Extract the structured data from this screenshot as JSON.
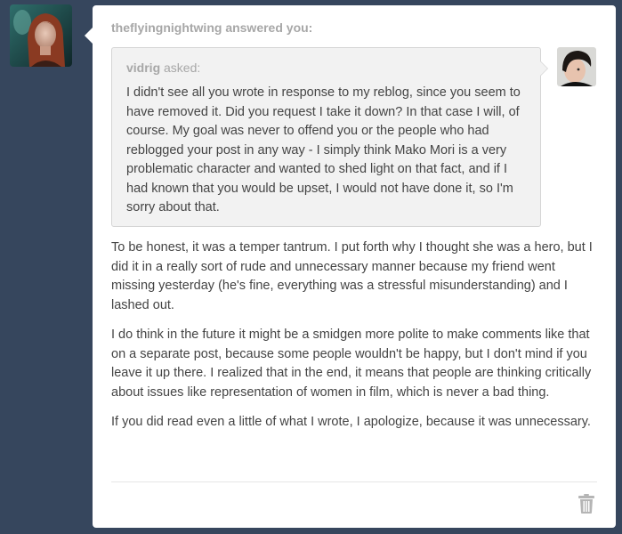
{
  "responder": {
    "username": "theflyingnightwing",
    "header_suffix": "answered you:"
  },
  "question": {
    "asker_name": "vidrig",
    "asked_label": "asked:",
    "text": "I didn't see all you wrote in response to my reblog, since you seem to have removed it. Did you request I take it down? In that case I will, of course. My goal was never to offend you or the people who had reblogged your post in any way - I simply think Mako Mori is a very problematic character and wanted to shed light on that fact, and if I had known that you would be upset, I would not have done it, so I'm sorry about that."
  },
  "answer": {
    "paragraphs": [
      "To be honest, it was a temper tantrum. I put forth why I thought she was a hero, but I did it in a really sort of rude and unnecessary manner because my friend went missing yesterday (he's fine, everything was a stressful misunderstanding) and I lashed out.",
      "I do think in the future it might be a smidgen more polite to make comments like that on a separate post, because some people wouldn't be happy, but I don't mind if you leave it up there. I realized that in the end, it means that people are thinking critically about issues like representation of women in film, which is never a bad thing.",
      "If you did read even a little of what I wrote, I apologize, because it was unnecessary."
    ]
  },
  "icons": {
    "delete": "trash-icon"
  },
  "colors": {
    "background": "#36465d",
    "card": "#ffffff",
    "question_bg": "#f2f2f2",
    "meta_text": "#a7a7a7",
    "body_text": "#444444"
  }
}
